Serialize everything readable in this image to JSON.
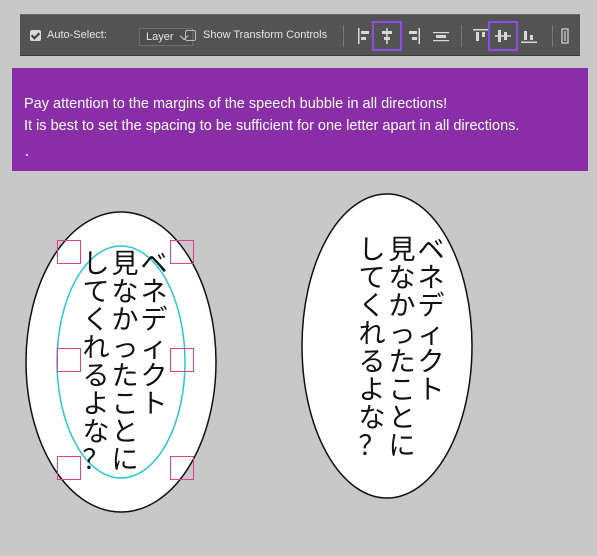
{
  "toolbar": {
    "auto_select_label": "Auto-Select:",
    "auto_select_checked": true,
    "layer_select_value": "Layer",
    "show_transform_label": "Show Transform Controls",
    "show_transform_checked": false,
    "align_buttons": [
      {
        "name": "align-left-edges",
        "highlighted": false
      },
      {
        "name": "align-horizontal-centers",
        "highlighted": true
      },
      {
        "name": "align-right-edges",
        "highlighted": false
      },
      {
        "name": "distribute",
        "highlighted": false
      },
      {
        "name": "align-top-edges",
        "highlighted": false
      },
      {
        "name": "align-vertical-centers",
        "highlighted": true
      },
      {
        "name": "align-bottom-edges",
        "highlighted": false
      },
      {
        "name": "more-options",
        "highlighted": false
      }
    ],
    "highlight_color": "#8c4de8"
  },
  "banner": {
    "line1": "Pay attention to the margins of the speech bubble in all directions!",
    "line2": "It is best to set the spacing to be sufficient for one letter apart in all directions.",
    "background": "#8a2ea8"
  },
  "bubbles": {
    "left": {
      "columns": [
        "ベネディクト",
        "見なかったことに",
        "してくれるよな？"
      ],
      "guide_color": "#27c8cf",
      "handle_color": "#e0408f"
    },
    "right": {
      "columns": [
        "ベネディクト",
        "見なかったことに",
        "してくれるよな？"
      ]
    }
  }
}
